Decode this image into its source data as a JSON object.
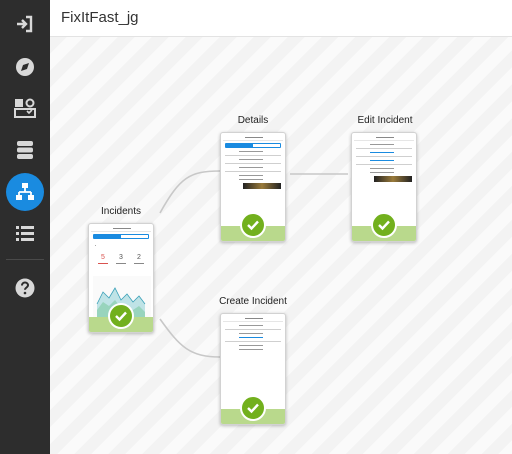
{
  "app": {
    "title": "FixItFast_jg"
  },
  "sidebar": {
    "items": [
      {
        "icon": "sign-in-icon",
        "active": false
      },
      {
        "icon": "compass-icon",
        "active": false
      },
      {
        "icon": "checklist-icon",
        "active": false
      },
      {
        "icon": "database-icon",
        "active": false
      },
      {
        "icon": "sitemap-icon",
        "active": true
      },
      {
        "icon": "list-icon",
        "active": false
      },
      {
        "icon": "help-icon",
        "active": false
      }
    ]
  },
  "flow": {
    "screens": [
      {
        "id": "incidents",
        "label": "Incidents",
        "status": "complete"
      },
      {
        "id": "details",
        "label": "Details",
        "status": "complete"
      },
      {
        "id": "edit-incident",
        "label": "Edit Incident",
        "status": "complete"
      },
      {
        "id": "create-incident",
        "label": "Create Incident",
        "status": "complete"
      }
    ]
  },
  "colors": {
    "sidebar_bg": "#2d2d2d",
    "accent": "#1a8be0",
    "check_green": "#72b01d",
    "card_footer": "#b9d98c"
  }
}
